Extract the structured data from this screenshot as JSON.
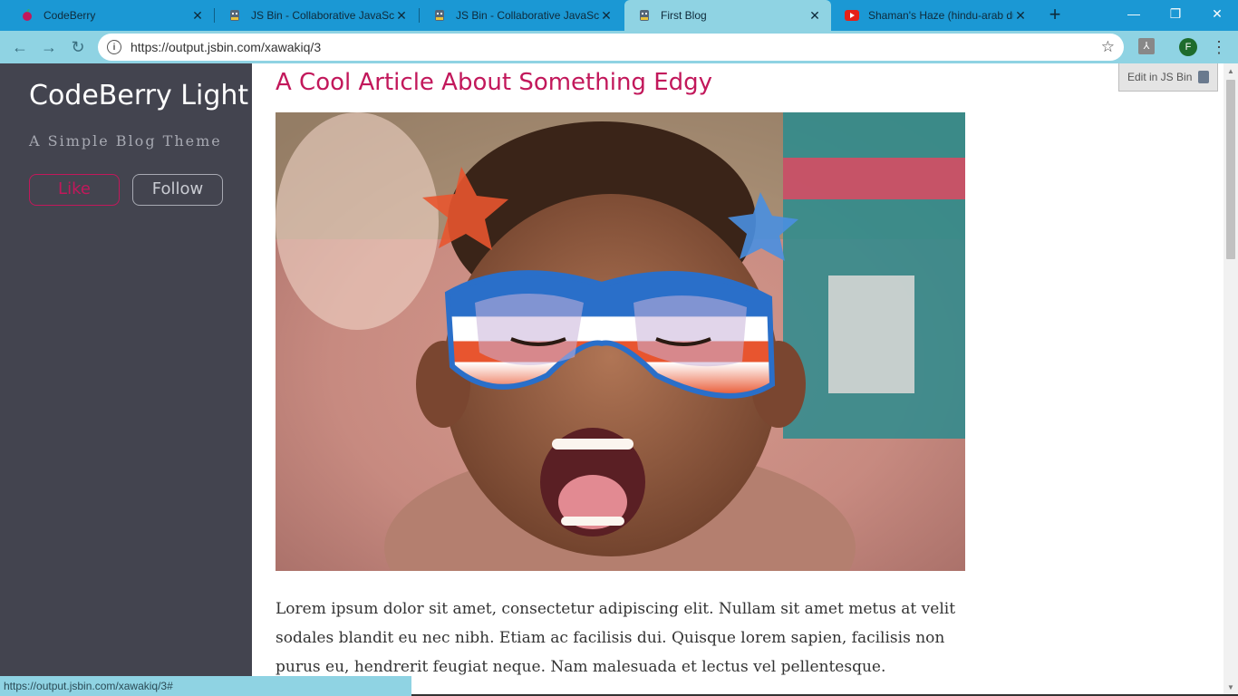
{
  "browser": {
    "tabs": [
      {
        "title": "CodeBerry",
        "active": false,
        "icon": "codeberry-icon"
      },
      {
        "title": "JS Bin - Collaborative JavaScript",
        "active": false,
        "icon": "jsbin-icon"
      },
      {
        "title": "JS Bin - Collaborative JavaScript",
        "active": false,
        "icon": "jsbin-icon"
      },
      {
        "title": "First Blog",
        "active": true,
        "icon": "jsbin-icon"
      },
      {
        "title": "Shaman's Haze (hindu-arab du",
        "active": false,
        "icon": "youtube-icon"
      }
    ],
    "url": "https://output.jsbin.com/xawakiq/3",
    "profile_initial": "F",
    "status_url": "https://output.jsbin.com/xawakiq/3#"
  },
  "sidebar": {
    "blog_title": "CodeBerry Light",
    "tagline": "A Simple Blog Theme",
    "like_label": "Like",
    "follow_label": "Follow"
  },
  "article": {
    "title": "A Cool Article About Something Edgy",
    "body": "Lorem ipsum dolor sit amet, consectetur adipiscing elit. Nullam sit amet metus at velit sodales blandit eu nec nibh. Etiam ac facilisis dui. Quisque lorem sapien, facilisis non purus eu, hendrerit feugiat neque. Nam malesuada et lectus vel pellentesque."
  },
  "jsbin": {
    "edit_label": "Edit in JS Bin"
  },
  "colors": {
    "accent": "#c2185b",
    "sidebar_bg": "#43444f",
    "chrome_tabstrip": "#1b98d4",
    "chrome_toolbar": "#8fd3e3"
  }
}
